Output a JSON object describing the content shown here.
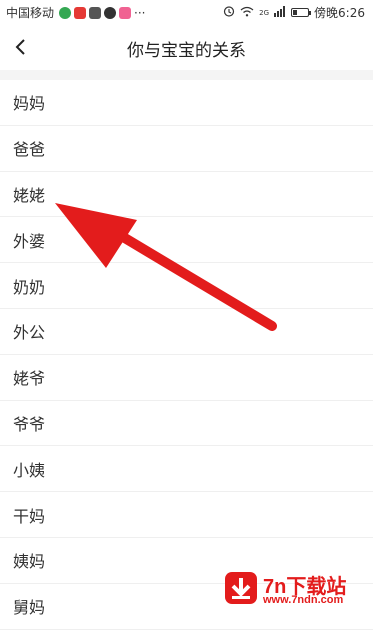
{
  "status_bar": {
    "carrier": "中国移动",
    "time_label": "傍晚6:26",
    "network_label": "2G",
    "app_icons": [
      "browser-icon",
      "music-icon",
      "app-icon",
      "qq-icon",
      "video-icon"
    ],
    "more": "···",
    "battery_level": 0.25
  },
  "header": {
    "title": "你与宝宝的关系"
  },
  "relations": [
    {
      "label": "妈妈"
    },
    {
      "label": "爸爸"
    },
    {
      "label": "姥姥"
    },
    {
      "label": "外婆"
    },
    {
      "label": "奶奶"
    },
    {
      "label": "外公"
    },
    {
      "label": "姥爷"
    },
    {
      "label": "爷爷"
    },
    {
      "label": "小姨"
    },
    {
      "label": "干妈"
    },
    {
      "label": "姨妈"
    },
    {
      "label": "舅妈"
    }
  ],
  "watermark": {
    "title": "7n下载站",
    "url": "www.7ndn.com"
  },
  "colors": {
    "arrow": "#e31c1c",
    "watermark": "#e31c1c"
  }
}
